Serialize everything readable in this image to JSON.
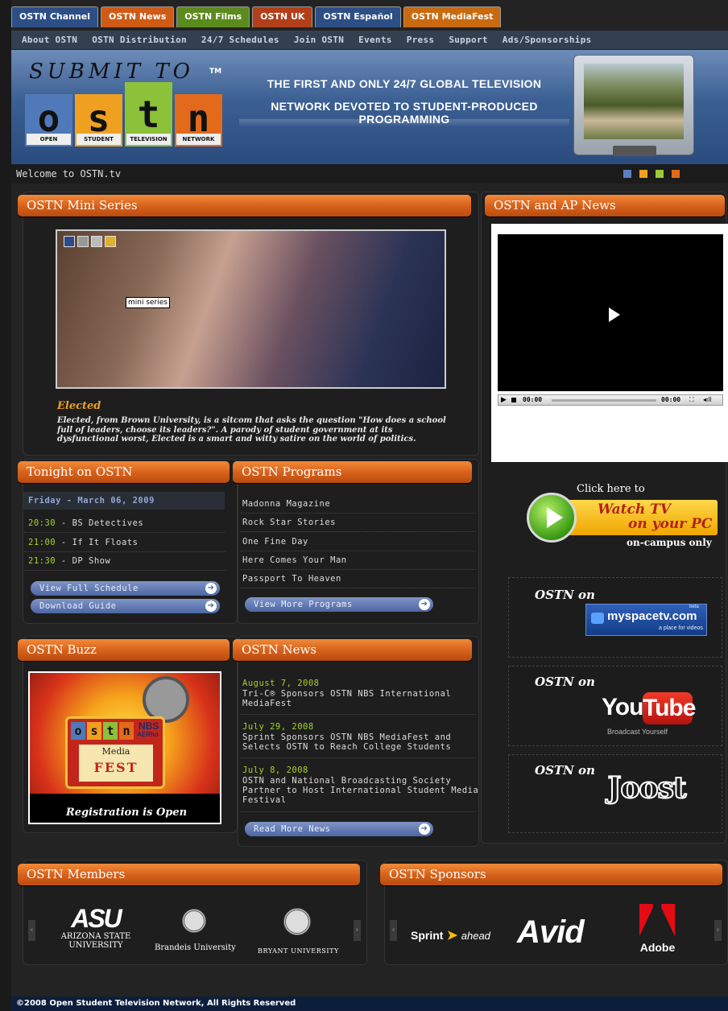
{
  "top_tabs": [
    {
      "label": "OSTN Channel",
      "color": "#2d4f85"
    },
    {
      "label": "OSTN News",
      "color": "#cf5b16"
    },
    {
      "label": "OSTN Films",
      "color": "#5b8b1d"
    },
    {
      "label": "OSTN UK",
      "color": "#b1401a"
    },
    {
      "label": "OSTN Español",
      "color": "#2d4f85"
    },
    {
      "label": "OSTN MediaFest",
      "color": "#c96a10"
    }
  ],
  "nav": [
    "About OSTN",
    "OSTN Distribution",
    "24/7 Schedules",
    "Join OSTN",
    "Events",
    "Press",
    "Support",
    "Ads/Sponsorships"
  ],
  "banner": {
    "logo_script": "SUBMIT TO",
    "letters": [
      "o",
      "s",
      "t",
      "n"
    ],
    "letter_labels": [
      "OPEN",
      "STUDENT",
      "TELEVISION",
      "NETWORK"
    ],
    "tm": "TM",
    "tagline_1": "THE FIRST AND ONLY 24/7 GLOBAL TELEVISION",
    "tagline_2": "NETWORK DEVOTED TO STUDENT-PRODUCED PROGRAMMING",
    "dot_colors": [
      "#5a7fc1",
      "#f0a020",
      "#9cc93a",
      "#e36a1b"
    ]
  },
  "welcome": "Welcome to OSTN.tv",
  "mini_series": {
    "title": "OSTN Mini Series",
    "tooltip": "mini series",
    "show": "Elected",
    "desc": "Elected, from Brown University, is a sitcom that asks the question \"How does a school full of leaders, choose its leaders?\".  A parody of student government at its dysfunctional worst, Elected is a smart and witty satire on the world of politics."
  },
  "ap_news": {
    "title": "OSTN and AP News",
    "time_left": "00:00",
    "time_right": "00:00"
  },
  "tonight": {
    "title": "Tonight on OSTN",
    "date": "Friday - March 06, 2009",
    "items": [
      {
        "time": "20:30",
        "show": " - BS Detectives"
      },
      {
        "time": "21:00",
        "show": " - If It Floats"
      },
      {
        "time": "21:30",
        "show": " - DP Show"
      }
    ],
    "btn_schedule": "View Full Schedule",
    "btn_guide": "Download Guide"
  },
  "programs": {
    "title": "OSTN Programs",
    "items": [
      "Madonna Magazine",
      "Rock Star Stories",
      "One Fine Day",
      "Here Comes Your Man",
      "Passport To Heaven"
    ],
    "btn": "View More Programs"
  },
  "watch": {
    "click": "Click here to",
    "line1": "Watch TV",
    "line2": "on your PC",
    "note": "on-campus only"
  },
  "ostn_on": "OSTN on",
  "myspace": {
    "name": "myspacetv.com",
    "sub": "a place for videos",
    "beta": "beta"
  },
  "youtube": {
    "you": "You",
    "tube": "Tube",
    "sub": "Broadcast Yourself"
  },
  "joost": "Joost",
  "buzz": {
    "title": "OSTN Buzz",
    "letters": [
      "o",
      "s",
      "t",
      "n"
    ],
    "nbs": "NBS",
    "aerho": "AERho",
    "media": "Media",
    "fest": "FEST",
    "caption": "Registration is Open"
  },
  "news": {
    "title": "OSTN News",
    "items": [
      {
        "date": "August 7, 2008",
        "lines": [
          "Tri-C® Sponsors OSTN NBS International",
          "MediaFest"
        ]
      },
      {
        "date": "July 29, 2008",
        "lines": [
          "Sprint Sponsors OSTN NBS MediaFest and",
          "Selects OSTN to Reach College Students"
        ]
      },
      {
        "date": "July 8, 2008",
        "lines": [
          "OSTN and National Broadcasting Society",
          "Partner to Host International Student Media",
          "Festival"
        ]
      }
    ],
    "btn": "Read More News"
  },
  "members": {
    "title": "OSTN Members",
    "asu": "ASU",
    "asu_l1": "ARIZONA STATE",
    "asu_l2": "UNIVERSITY",
    "brandeis": "Brandeis University",
    "bryant": "BRYANT UNIVERSITY"
  },
  "sponsors": {
    "title": "OSTN Sponsors",
    "sprint": "Sprint",
    "ahead": "ahead",
    "avid": "Avid",
    "adobe": "Adobe"
  },
  "footer": "©2008 Open Student Television Network, All Rights Reserved"
}
